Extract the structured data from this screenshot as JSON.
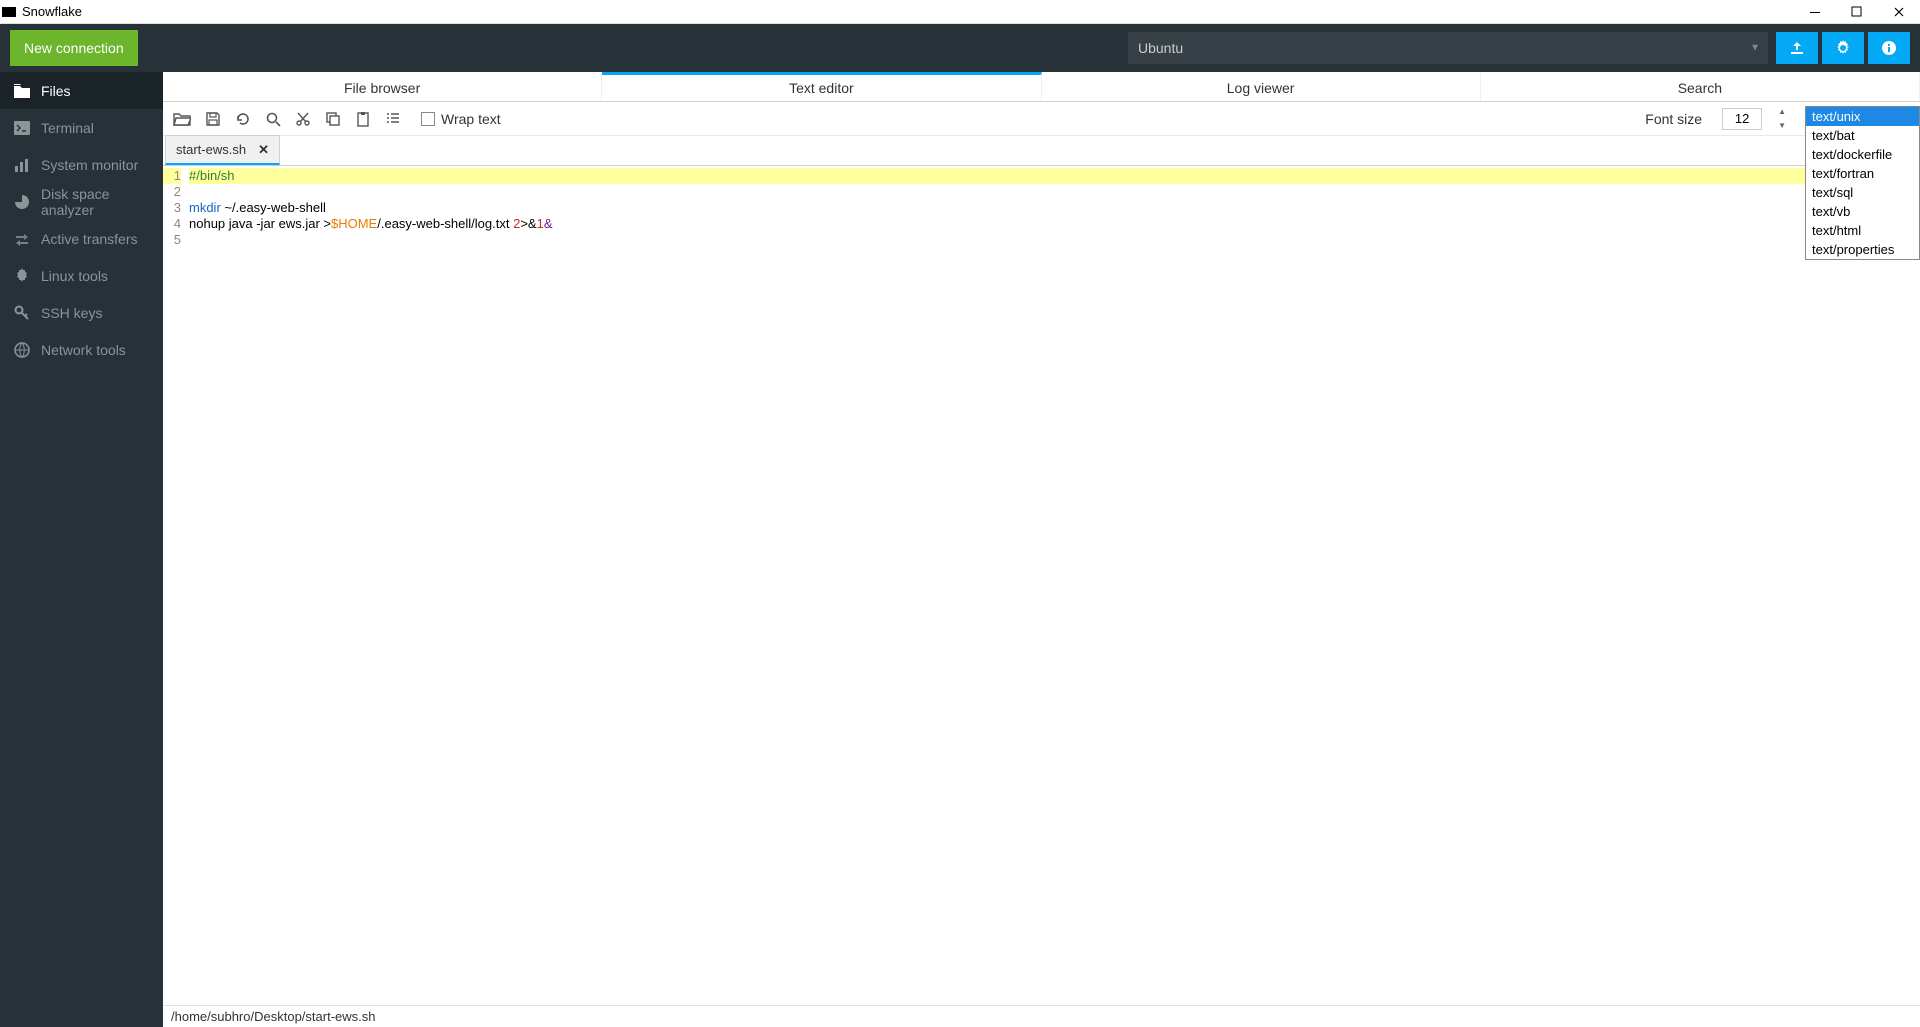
{
  "window": {
    "title": "Snowflake"
  },
  "header": {
    "new_connection": "New connection",
    "dropdown": "Ubuntu"
  },
  "sidebar": {
    "items": [
      {
        "label": "Files",
        "active": true
      },
      {
        "label": "Terminal"
      },
      {
        "label": "System monitor"
      },
      {
        "label": "Disk space analyzer"
      },
      {
        "label": "Active transfers"
      },
      {
        "label": "Linux tools"
      },
      {
        "label": "SSH keys"
      },
      {
        "label": "Network tools"
      }
    ]
  },
  "main_tabs": [
    {
      "label": "File browser"
    },
    {
      "label": "Text editor"
    },
    {
      "label": "Log viewer"
    },
    {
      "label": "Search"
    }
  ],
  "toolbar": {
    "wrap_text": "Wrap text",
    "font_size_label": "Font size",
    "font_size_value": "12",
    "syntax_value": "text/unix"
  },
  "file_tab": {
    "name": "start-ews.sh"
  },
  "editor": {
    "lines": {
      "l1": "#/bin/sh",
      "l3_mkdir": "mkdir",
      "l3_rest": " ~/.easy-web-shell",
      "l4_a": "nohup java -jar ews.jar >",
      "l4_home": "$HOME",
      "l4_b": "/.easy-web-shell/log.txt ",
      "l4_two": "2",
      "l4_gt": ">&",
      "l4_one": "1",
      "l4_amp": "&"
    },
    "gutter": [
      "1",
      "2",
      "3",
      "4",
      "5"
    ]
  },
  "syntax_options": [
    "text/unix",
    "text/bat",
    "text/dockerfile",
    "text/fortran",
    "text/sql",
    "text/vb",
    "text/html",
    "text/properties"
  ],
  "statusbar": {
    "path": "/home/subhro/Desktop/start-ews.sh"
  }
}
